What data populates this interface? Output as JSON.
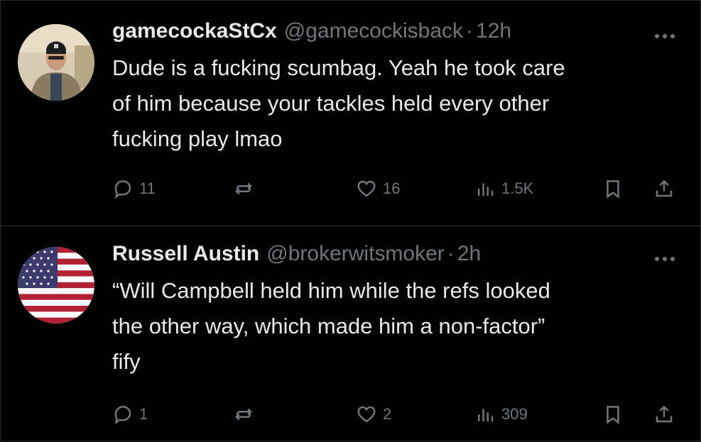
{
  "tweets": [
    {
      "name": "gamecockaStCx",
      "handle": "@gamecockisback",
      "sep": "·",
      "time": "12h",
      "lines": [
        "Dude is a fucking scumbag. Yeah he took care",
        "of him because your tackles held every other",
        "fucking play lmao"
      ],
      "replies": "11",
      "retweets": "",
      "likes": "16",
      "views": "1.5K"
    },
    {
      "name": "Russell Austin",
      "handle": "@brokerwitsmoker",
      "sep": "·",
      "time": "2h",
      "lines": [
        "“Will Campbell held him while the refs looked",
        "the other way, which made him a non-factor”",
        "fify"
      ],
      "replies": "1",
      "retweets": "",
      "likes": "2",
      "views": "309"
    }
  ],
  "icons": {
    "reply": "reply-icon",
    "retweet": "retweet-icon",
    "like": "heart-icon",
    "views": "views-icon",
    "bookmark": "bookmark-icon",
    "share": "share-icon",
    "more": "more-icon"
  },
  "colors": {
    "background": "#000000",
    "text": "#e7e9ea",
    "secondary": "#71767b",
    "divider": "#2f3336"
  }
}
